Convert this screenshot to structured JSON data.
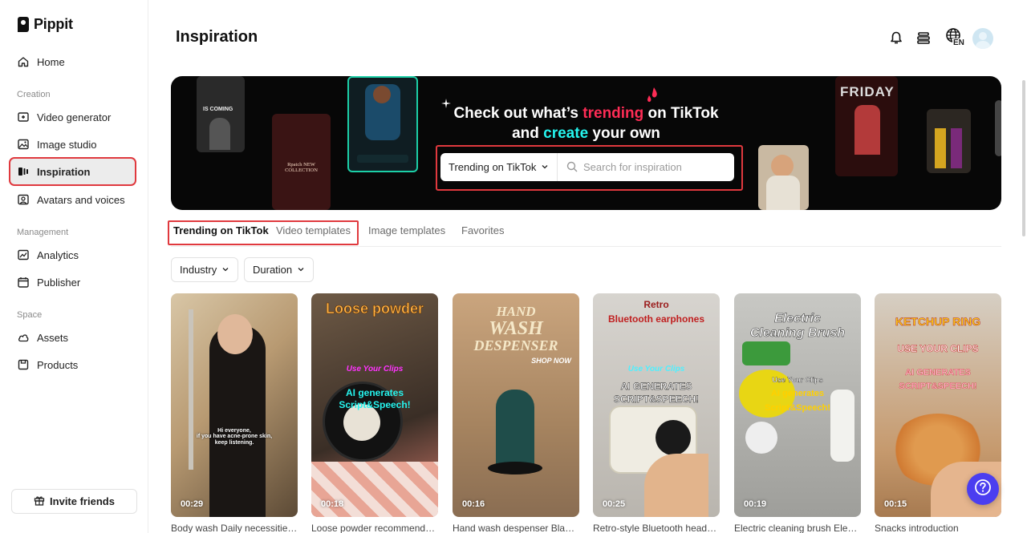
{
  "app": {
    "name": "Pippit"
  },
  "sidebar": {
    "home": "Home",
    "sections": {
      "creation": "Creation",
      "management": "Management",
      "space": "Space"
    },
    "creation_items": [
      "Video generator",
      "Image studio",
      "Inspiration",
      "Avatars and voices"
    ],
    "management_items": [
      "Analytics",
      "Publisher"
    ],
    "space_items": [
      "Assets",
      "Products"
    ],
    "active_item": "Inspiration",
    "invite_label": "Invite friends"
  },
  "header": {
    "title": "Inspiration",
    "language": "EN",
    "icons": [
      "bell-icon",
      "layers-icon",
      "globe-icon",
      "avatar"
    ]
  },
  "banner": {
    "line1_pre": "Check out what’s ",
    "line1_hl": "trending",
    "line1_post": " on TikTok",
    "line2_pre": "and ",
    "line2_hl": "create",
    "line2_post": " your own",
    "search": {
      "type_selected": "Trending on TikTok",
      "placeholder": "Search for inspiration"
    },
    "phone_texts": [
      "IS COMING",
      "Rpatch NEW COLLECTION",
      "FRIDAY"
    ]
  },
  "tabs": [
    "Trending on TikTok",
    "Video templates",
    "Image templates",
    "Favorites"
  ],
  "active_tab": "Trending on TikTok",
  "filters": [
    "Industry",
    "Duration"
  ],
  "cards": [
    {
      "duration": "00:29",
      "caption": "Body wash Daily necessities...",
      "overlay": [
        "Hi everyone,",
        "if you have acne-prone skin,",
        "keep listening."
      ]
    },
    {
      "duration": "00:18",
      "caption": "Loose powder recommendation...",
      "overlay": [
        "Loose powder",
        "Use Your Clips",
        "AI generates",
        "Script&Speech!"
      ]
    },
    {
      "duration": "00:16",
      "caption": "Hand wash despenser Black...",
      "overlay": [
        "HAND",
        "WASH",
        "DESPENSER",
        "SHOP NOW"
      ]
    },
    {
      "duration": "00:25",
      "caption": "Retro-style Bluetooth headphones...",
      "overlay": [
        "Retro",
        "Bluetooth earphones",
        "Use Your Clips",
        "AI GENERATES",
        "SCRIPT&SPEECH!"
      ]
    },
    {
      "duration": "00:19",
      "caption": "Electric cleaning brush Electronics...",
      "overlay": [
        "Electric",
        "Cleaning Brush",
        "Use Your Clips",
        "AI generates",
        "Script&Speech!"
      ]
    },
    {
      "duration": "00:15",
      "caption": "Snacks introduction",
      "overlay": [
        "KETCHUP RING",
        "USE YOUR CLIPS",
        "AI GENERATES",
        "SCRIPT&SPEECH!"
      ]
    }
  ],
  "colors": {
    "accent_red": "#fe2c55",
    "accent_cyan": "#25f4ee",
    "help_button": "#4b3ef0",
    "highlight_outline": "#e0393e"
  }
}
